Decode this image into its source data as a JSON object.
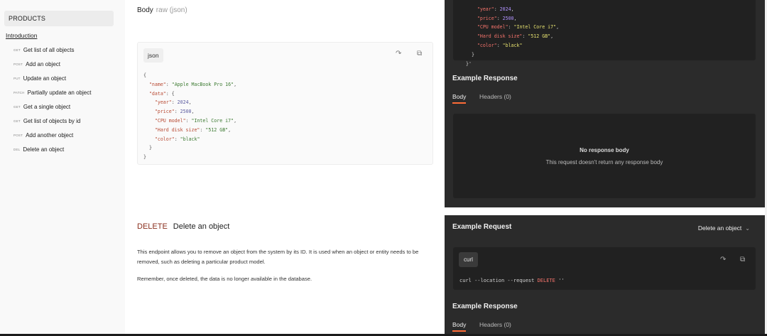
{
  "sidebar": {
    "section_title": "PRODUCTS",
    "intro_link": "Introduction",
    "items": [
      {
        "method": "GET",
        "label": "Get list of all objects"
      },
      {
        "method": "POST",
        "label": "Add an object"
      },
      {
        "method": "PUT",
        "label": "Update an object"
      },
      {
        "method": "PATCH",
        "label": "Partially update an object"
      },
      {
        "method": "GET",
        "label": "Get a single object"
      },
      {
        "method": "GET",
        "label": "Get list of objects by id"
      },
      {
        "method": "POST",
        "label": "Add another object"
      },
      {
        "method": "DEL",
        "label": "Delete an object"
      }
    ]
  },
  "main": {
    "body_label": "Body",
    "body_type": "raw (json)",
    "code_lang": "json",
    "code_lines": {
      "l1": "{",
      "l2_key": "\"name\"",
      "l2_val": "\"Apple MacBook Pro 16\"",
      "l3_key": "\"data\"",
      "l3_rest": ": {",
      "l4_key": "\"year\"",
      "l4_val": "2024",
      "l5_key": "\"price\"",
      "l5_val": "2500",
      "l6_key": "\"CPU model\"",
      "l6_val": "\"Intel Core i7\"",
      "l7_key": "\"Hard disk size\"",
      "l7_val": "\"512 GB\"",
      "l8_key": "\"color\"",
      "l8_val": "\"black\"",
      "l9": "}",
      "l10": "}"
    },
    "delete_method": "DELETE",
    "delete_title": "Delete an object",
    "delete_desc": "This endpoint allows you to remove an object from the system by its ID. It is used when an object or entity needs to be removed, such as deleting a particular product model.",
    "delete_note": "Remember, once deleted, the data is no longer available in the database."
  },
  "right_top": {
    "code": {
      "year_key": "\"year\"",
      "year_val": "2024",
      "price_key": "\"price\"",
      "price_val": "2500",
      "cpu_key": "\"CPU model\"",
      "cpu_val": "\"Intel Core i7\"",
      "disk_key": "\"Hard disk size\"",
      "disk_val": "\"512 GB\"",
      "color_key": "\"color\"",
      "color_val": "\"black\"",
      "close_inner": "}",
      "close_outer": "}'"
    },
    "response_title": "Example Response",
    "tab_body": "Body",
    "tab_headers": "Headers (0)",
    "no_body_title": "No response body",
    "no_body_desc": "This request doesn't return any response body"
  },
  "right_bottom": {
    "request_title": "Example Request",
    "request_select": "Delete an object",
    "curl_label": "curl",
    "curl_cmd_prefix": "curl --location --request ",
    "curl_cmd_method": "DELETE",
    "curl_cmd_suffix": " ''",
    "response_title": "Example Response",
    "tab_body": "Body",
    "tab_headers": "Headers (0)"
  },
  "colors": {
    "accent": "#ff6c37",
    "dark_panel": "#2b2b2b",
    "delete_method": "#8a2f1d"
  }
}
